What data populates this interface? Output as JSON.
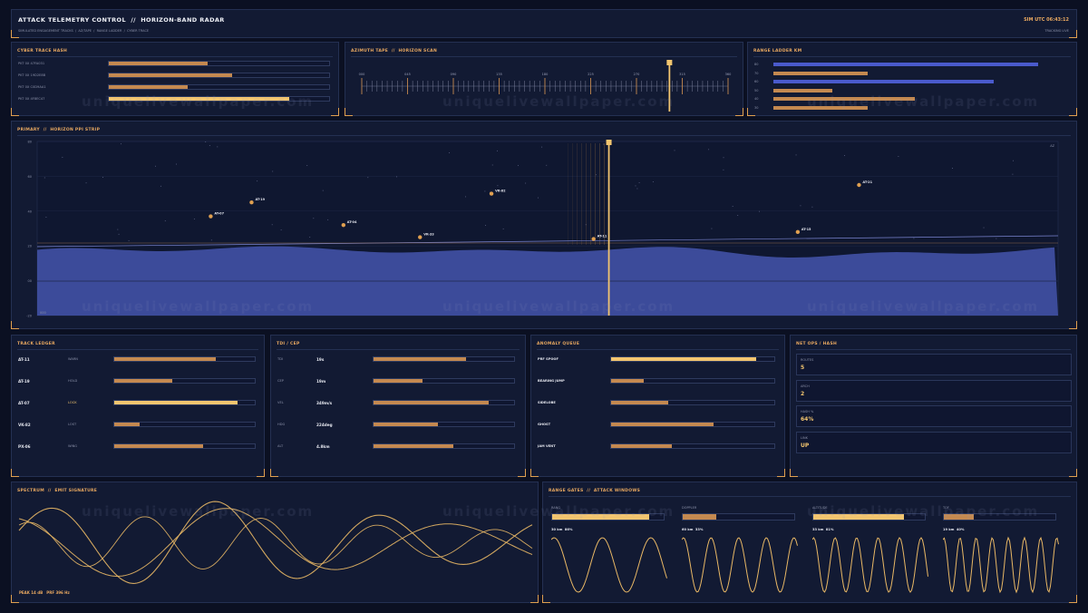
{
  "colors": {
    "orange": "#e0a050",
    "amber": "#f3c56f",
    "copper": "#c48950",
    "blue": "#4a58b8",
    "blue_dim": "#3b4a9a",
    "bg": "#0b1022",
    "panel": "#121a33"
  },
  "header": {
    "title": "ATTACK TELEMETRY CONTROL  //  HORIZON-BAND RADAR",
    "breadcrumb": "SIMULATED ENGAGEMENT TRACKS  /  AZ/TAPE  /  RANGE LADDER  /  CYBER TRACE",
    "clock": "SIM UTC 06:43:12",
    "status": "TRACKING LIVE"
  },
  "watermark": "uniquelivewallpaper.com",
  "cyber": {
    "title": "CYBER TRACE HASH",
    "rows": [
      {
        "label": "PKT 0X 47FA031",
        "value": 0.45
      },
      {
        "label": "PKT 0X 19D2E8B",
        "value": 0.56
      },
      {
        "label": "PKT 0X C0D9AA1",
        "value": 0.36
      },
      {
        "label": "PKT 0X 4F8EC47",
        "value": 0.82
      }
    ]
  },
  "azimuth": {
    "title": "AZIMUTH TAPE  //  HORIZON SCAN",
    "ticks": [
      "000",
      "045",
      "090",
      "135",
      "180",
      "225",
      "270",
      "315",
      "360"
    ],
    "cursor": 0.84
  },
  "range_ladder": {
    "title": "RANGE LADDER  km",
    "rows": [
      {
        "label": "80",
        "value": 0.9,
        "kind": "blue"
      },
      {
        "label": "70",
        "value": 0.32,
        "kind": "orange"
      },
      {
        "label": "60",
        "value": 0.75,
        "kind": "blue"
      },
      {
        "label": "50",
        "value": 0.2,
        "kind": "orange"
      },
      {
        "label": "40",
        "value": 0.48,
        "kind": "orange"
      },
      {
        "label": "30",
        "value": 0.32,
        "kind": "orange"
      }
    ]
  },
  "primary": {
    "title": "PRIMARY  //  HORIZON PPI STRIP",
    "y_ticks": [
      "80",
      "60",
      "40",
      "20",
      "00",
      "-20"
    ],
    "corner": "AZ",
    "corner_bl": "000",
    "cursor": 0.56,
    "targets": [
      {
        "id": "AT-07",
        "x": 0.17,
        "y": 0.43
      },
      {
        "id": "AT-19",
        "x": 0.21,
        "y": 0.35
      },
      {
        "id": "AT-04",
        "x": 0.3,
        "y": 0.48
      },
      {
        "id": "VK-33",
        "x": 0.375,
        "y": 0.55
      },
      {
        "id": "VK-82",
        "x": 0.445,
        "y": 0.3
      },
      {
        "id": "AT-11",
        "x": 0.545,
        "y": 0.56
      },
      {
        "id": "AT-15",
        "x": 0.745,
        "y": 0.52
      },
      {
        "id": "AT-21",
        "x": 0.805,
        "y": 0.25
      }
    ]
  },
  "track_ledger": {
    "title": "TRACK LEDGER",
    "rows": [
      {
        "id": "AT-11",
        "state": "WARN",
        "value": 0.72
      },
      {
        "id": "AT-19",
        "state": "HOLD",
        "value": 0.41
      },
      {
        "id": "AT-07",
        "state": "LOCK",
        "value": 0.88
      },
      {
        "id": "VK-82",
        "state": "LOST",
        "value": 0.18
      },
      {
        "id": "PX-06",
        "state": "WING",
        "value": 0.63
      }
    ]
  },
  "tdi": {
    "title": "TDI / CEP",
    "rows": [
      {
        "label": "TDI",
        "value": "19s",
        "level": 0.66
      },
      {
        "label": "CEP",
        "value": "19m",
        "level": 0.35
      },
      {
        "label": "VEL",
        "value": "349m/s",
        "level": 0.82
      },
      {
        "label": "HDG",
        "value": "224deg",
        "level": 0.46
      },
      {
        "label": "ALT",
        "value": "4.8km",
        "level": 0.57
      }
    ]
  },
  "anomaly": {
    "title": "ANOMALY QUEUE",
    "rows": [
      {
        "label": "PRF SPOOF",
        "value": 0.89,
        "bright": true
      },
      {
        "label": "BEARING JUMP",
        "value": 0.2
      },
      {
        "label": "SIDELOBE",
        "value": 0.35
      },
      {
        "label": "GHOST",
        "value": 0.63
      },
      {
        "label": "JAM VENT",
        "value": 0.37
      }
    ]
  },
  "netops": {
    "title": "NET OPS / HASH",
    "items": [
      {
        "label": "ROUTES",
        "value": "5"
      },
      {
        "label": "ARCH",
        "value": "2"
      },
      {
        "label": "HASH %",
        "value": "64%"
      },
      {
        "label": "LINK",
        "value": "UP"
      }
    ]
  },
  "spectrum": {
    "title": "SPECTRUM  //  EMIT SIGNATURE",
    "footer": "PEAK 14 dB   PRF 396 Hz"
  },
  "range_gates": {
    "title": "RANGE GATES  //  ATTACK WINDOWS",
    "gates": [
      {
        "label": "RANG",
        "value": 0.87,
        "caption": "30 km  86%",
        "freq": 2.4
      },
      {
        "label": "DOPPLER",
        "value": 0.3,
        "caption": "60 km  33%",
        "freq": 4.2
      },
      {
        "label": "ALTITUDE",
        "value": 0.81,
        "caption": "33 km  81%",
        "freq": 5.4
      },
      {
        "label": "TOF",
        "value": 0.27,
        "caption": "19 km  40%",
        "freq": 7.2
      }
    ]
  }
}
